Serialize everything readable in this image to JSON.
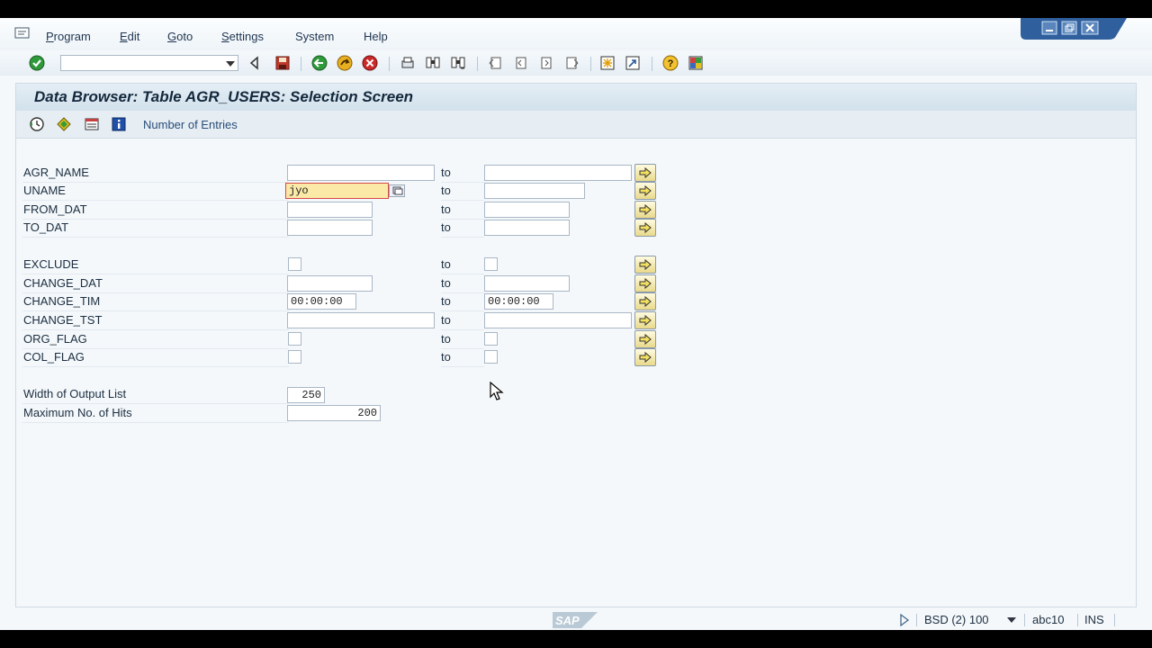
{
  "menu": {
    "items": [
      {
        "key": "P",
        "rest": "rogram"
      },
      {
        "key": "E",
        "rest": "dit"
      },
      {
        "key": "G",
        "rest": "oto"
      },
      {
        "key": "S",
        "rest": "ettings"
      },
      {
        "key": "S",
        "rest": "ystem"
      },
      {
        "key": "H",
        "rest": "elp"
      }
    ]
  },
  "toolbar": {
    "command_field_value": "",
    "icons": [
      "enter-icon",
      "back-nav-icon",
      "save-icon",
      "back-icon",
      "exit-icon",
      "cancel-icon",
      "print-icon",
      "find-icon",
      "find-next-icon",
      "first-page-icon",
      "previous-page-icon",
      "next-page-icon",
      "last-page-icon",
      "create-session-icon",
      "shortcut-icon",
      "help-icon",
      "layout-icon"
    ]
  },
  "title": "Data Browser: Table AGR_USERS: Selection Screen",
  "app_toolbar": {
    "icons": [
      "execute-icon",
      "selection-options-icon",
      "multiple-selection-icon",
      "info-icon"
    ],
    "number_of_entries": "Number of Entries"
  },
  "form": {
    "to_label": "to",
    "rows": [
      {
        "label": "AGR_NAME",
        "low": "",
        "high": ""
      },
      {
        "label": "UNAME",
        "low": "jyo",
        "high": ""
      },
      {
        "label": "FROM_DAT",
        "low": "",
        "high": ""
      },
      {
        "label": "TO_DAT",
        "low": "",
        "high": ""
      },
      {
        "label": "EXCLUDE",
        "low": "",
        "high": ""
      },
      {
        "label": "CHANGE_DAT",
        "low": "",
        "high": ""
      },
      {
        "label": "CHANGE_TIM",
        "low": "00:00:00",
        "high": "00:00:00"
      },
      {
        "label": "CHANGE_TST",
        "low": "",
        "high": ""
      },
      {
        "label": "ORG_FLAG",
        "low": "",
        "high": ""
      },
      {
        "label": "COL_FLAG",
        "low": "",
        "high": ""
      }
    ],
    "output_width_label": "Width of Output List",
    "output_width_value": "250",
    "max_hits_label": "Maximum No. of Hits",
    "max_hits_value": "200"
  },
  "statusbar": {
    "logo": "SAP",
    "system": "BSD (2) 100",
    "server": "abc10",
    "mode": "INS"
  },
  "colors": {
    "focus_field": "#fbe9a8",
    "title_text": "#14283c",
    "link_text": "#2a4d78"
  }
}
